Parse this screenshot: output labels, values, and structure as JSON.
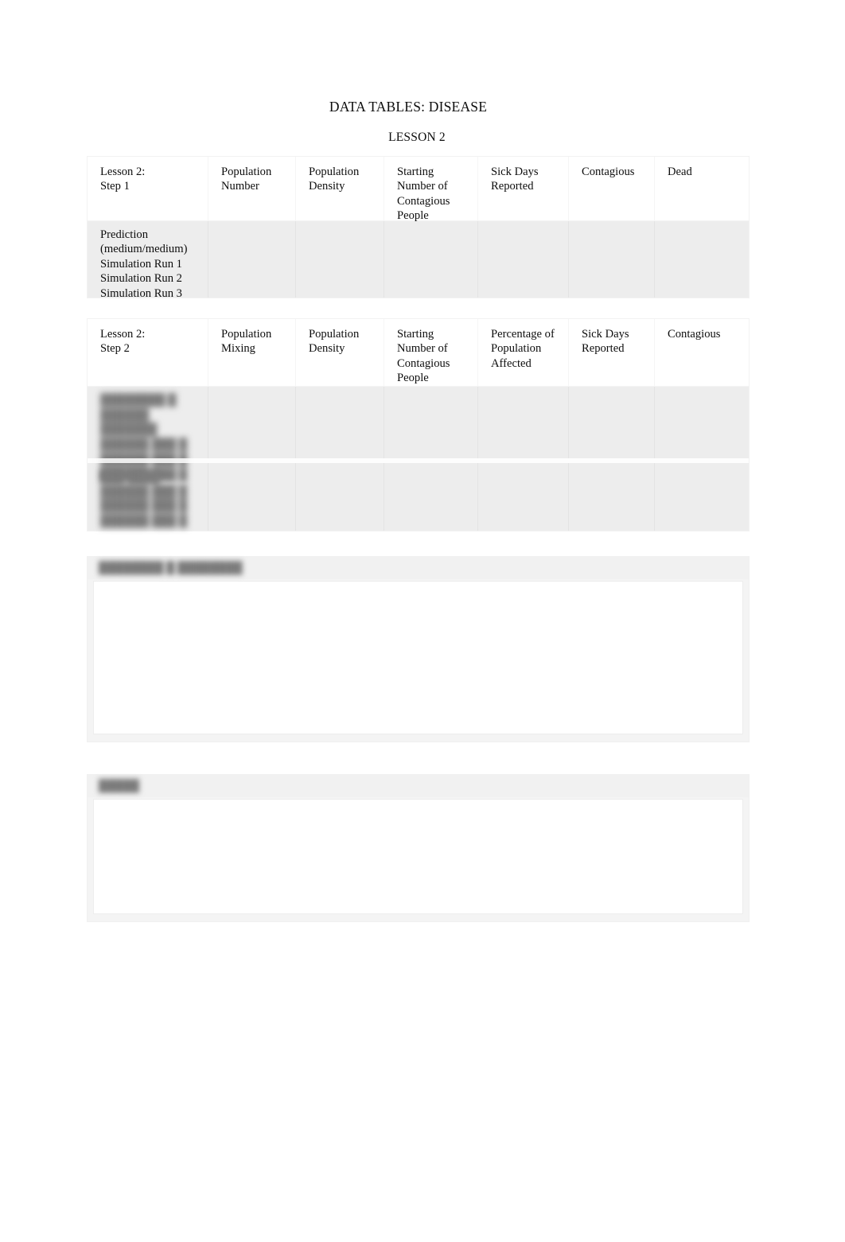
{
  "document": {
    "title": "DATA TABLES: DISEASE",
    "subtitle": "LESSON 2"
  },
  "table_step1": {
    "headers": [
      "Lesson 2:\nStep 1",
      "Population\nNumber",
      "Population\nDensity",
      "Starting\nNumber of\nContagious\nPeople",
      "Sick Days\nReported",
      "Contagious",
      "Dead"
    ],
    "row_labels": "Prediction\n(medium/medium)\nSimulation Run 1\nSimulation Run 2\nSimulation Run 3",
    "cells": [
      "",
      "",
      "",
      "",
      "",
      ""
    ]
  },
  "table_step2": {
    "headers": [
      "Lesson 2:\nStep 2",
      "Population\nMixing",
      "Population\nDensity",
      "Starting\nNumber of\nContagious\nPeople",
      "Percentage of\nPopulation\nAffected",
      "Sick Days\nReported",
      "Contagious"
    ],
    "group1_label": "████████ █\n██████ ███████\n██████ ███ █\n██████ ███ █\n██████ ███ █",
    "group2_label": "███ ████\n██████ ███ █\n██████ ███ █\n██████ ███ █",
    "cells": [
      "",
      "",
      "",
      "",
      "",
      ""
    ]
  },
  "panel_observations": {
    "heading": "████████  █  ████████",
    "content": ""
  },
  "panel_notes": {
    "heading": "█████",
    "content": ""
  }
}
